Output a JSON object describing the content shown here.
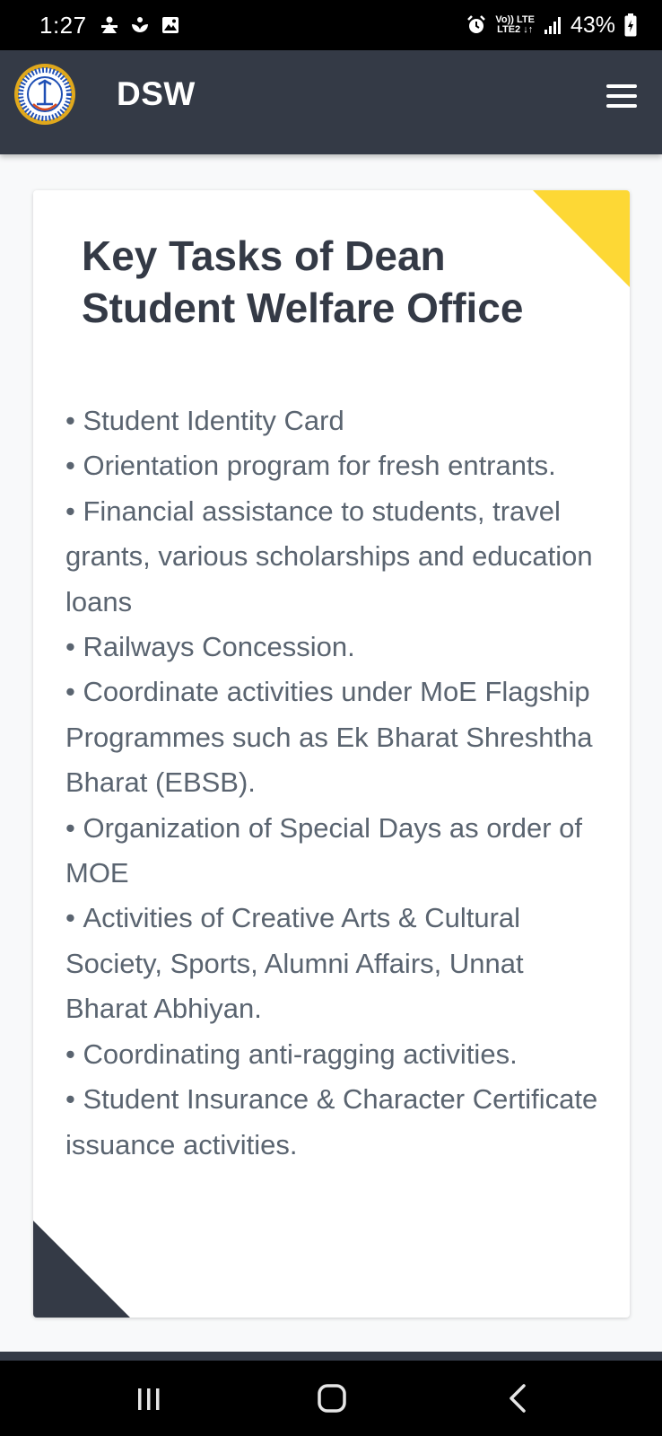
{
  "status_bar": {
    "time": "1:27",
    "battery": "43%",
    "net_top": "Vo)) LTE",
    "net_bottom": "LTE2 ↓↑",
    "icons": [
      "notification-person-icon",
      "notification-leaf-icon",
      "gallery-icon",
      "alarm-icon",
      "signal-icon",
      "battery-charging-icon"
    ]
  },
  "app_bar": {
    "title": "DSW",
    "logo": "institute-logo",
    "menu_icon": "hamburger-menu-icon"
  },
  "card": {
    "title": "Key Tasks of Dean Student Welfare Office",
    "accent_color": "#fdd835",
    "dark_color": "#343a46",
    "items": [
      "Student Identity Card",
      "Orientation program for fresh entrants.",
      "Financial assistance to students, travel grants, various scholarships and education loans",
      "Railways Concession.",
      "Coordinate activities under MoE Flagship Programmes such as Ek Bharat Shreshtha Bharat (EBSB).",
      "Organization of Special Days as order of MOE",
      "Activities of Creative Arts & Cultural Society, Sports, Alumni Affairs, Unnat Bharat Abhiyan.",
      "Coordinating anti-ragging activities.",
      "Student Insurance & Character Certificate issuance activities."
    ]
  },
  "nav_bar": {
    "recents_icon": "recents-icon",
    "home_icon": "home-icon",
    "back_icon": "back-icon"
  }
}
